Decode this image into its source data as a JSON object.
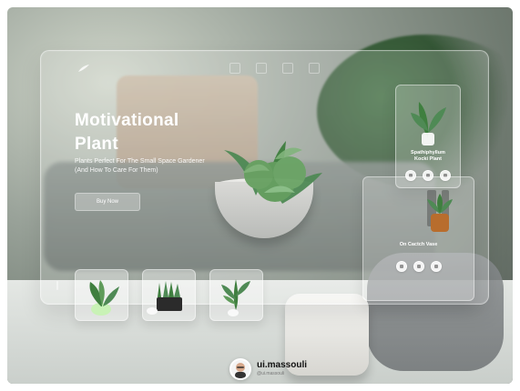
{
  "hero": {
    "title_line1": "Motivational",
    "title_line2": "Plant",
    "subtitle": "Plants Perfect For The Small Space Gardener (And How To Care For Them)",
    "cta_label": "Buy Now"
  },
  "header": {
    "logo_icon": "leaf-logo-icon",
    "social_icons": [
      "facebook-icon",
      "twitter-icon",
      "pinterest-icon",
      "instagram-icon"
    ]
  },
  "cards": [
    {
      "name_line1": "Spathiphyllum",
      "name_line2": "Kocki Plant",
      "actions": [
        "share-icon",
        "heart-icon",
        "cart-icon"
      ]
    },
    {
      "name_line1": "On Cactch Vase",
      "name_line2": "",
      "actions": [
        "share-icon",
        "heart-icon",
        "cart-icon"
      ]
    }
  ],
  "author": {
    "name": "ui.massouli",
    "handle": "@ui.massouli"
  },
  "colors": {
    "glass": "#ffffff",
    "leaf_green": "#3f7f3f",
    "text": "#ffffff"
  }
}
